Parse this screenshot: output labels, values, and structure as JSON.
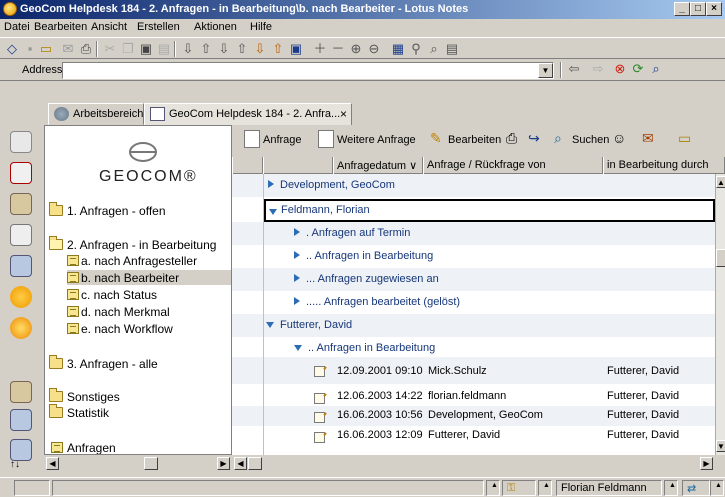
{
  "window": {
    "title": "GeoCom Helpdesk 184 - 2. Anfragen - in Bearbeitung\\b. nach Bearbeiter - Lotus Notes"
  },
  "menu": [
    "Datei",
    "Bearbeiten",
    "Ansicht",
    "Erstellen",
    "Aktionen",
    "Hilfe"
  ],
  "address": {
    "label": "Address",
    "value": ""
  },
  "tabs": [
    {
      "label": "Arbeitsbereich",
      "icon": "workspace-icon"
    },
    {
      "label": "GeoCom Helpdesk 184 - 2. Anfra...",
      "icon": "database-icon",
      "close": "×"
    }
  ],
  "logo": {
    "text": "GEOCOM®"
  },
  "nav": [
    {
      "label": "1. Anfragen - offen",
      "type": "folder"
    },
    {
      "label": "2. Anfragen - in Bearbeitung",
      "type": "folder-open"
    },
    {
      "label": "a. nach Anfragesteller",
      "type": "view"
    },
    {
      "label": "b. nach Bearbeiter",
      "type": "view",
      "selected": true
    },
    {
      "label": "c. nach Status",
      "type": "view"
    },
    {
      "label": "d. nach Merkmal",
      "type": "view"
    },
    {
      "label": "e. nach Workflow",
      "type": "view"
    },
    {
      "label": "3. Anfragen - alle",
      "type": "folder"
    },
    {
      "label": "Sonstiges",
      "type": "folder"
    },
    {
      "label": "Statistik",
      "type": "folder"
    },
    {
      "label": "Anfragen",
      "type": "view"
    }
  ],
  "actions": [
    {
      "label": "Anfrage",
      "icon": "new-doc-icon"
    },
    {
      "label": "Weitere Anfrage",
      "icon": "new-doc-icon"
    },
    {
      "label": "Bearbeiten",
      "icon": "pencil-icon"
    },
    {
      "label": "",
      "icon": "print-icon"
    },
    {
      "label": "",
      "icon": "forward-icon"
    },
    {
      "label": "Suchen",
      "icon": "search-icon"
    }
  ],
  "columns": [
    "Anfragedatum ∨",
    "Anfrage / Rückfrage von",
    "in Bearbeitung durch"
  ],
  "rows": [
    {
      "kind": "cat1",
      "open": false,
      "text": "Development, GeoCom"
    },
    {
      "kind": "cat1",
      "open": true,
      "text": "Feldmann, Florian",
      "selected": true
    },
    {
      "kind": "cat2",
      "open": false,
      "text": ". Anfragen auf Termin"
    },
    {
      "kind": "cat2",
      "open": false,
      "text": ".. Anfragen in Bearbeitung"
    },
    {
      "kind": "cat2",
      "open": false,
      "text": "... Anfragen zugewiesen an"
    },
    {
      "kind": "cat2",
      "open": false,
      "text": "..... Anfragen bearbeitet (gelöst)"
    },
    {
      "kind": "cat1",
      "open": true,
      "text": "Futterer, David"
    },
    {
      "kind": "cat2",
      "open": true,
      "text": ".. Anfragen in Bearbeitung"
    },
    {
      "kind": "doc",
      "date": "12.09.2001 09:10",
      "from": "Mick.Schulz",
      "by": "Futterer, David"
    },
    {
      "kind": "blank"
    },
    {
      "kind": "doc",
      "date": "12.06.2003 14:22",
      "from": "florian.feldmann",
      "by": "Futterer, David"
    },
    {
      "kind": "doc",
      "date": "16.06.2003 10:56",
      "from": "Development, GeoCom",
      "by": "Futterer, David"
    },
    {
      "kind": "doc",
      "date": "16.06.2003 12:09",
      "from": "Futterer, David",
      "by": "Futterer, David"
    }
  ],
  "status": {
    "user": "Florian Feldmann"
  }
}
